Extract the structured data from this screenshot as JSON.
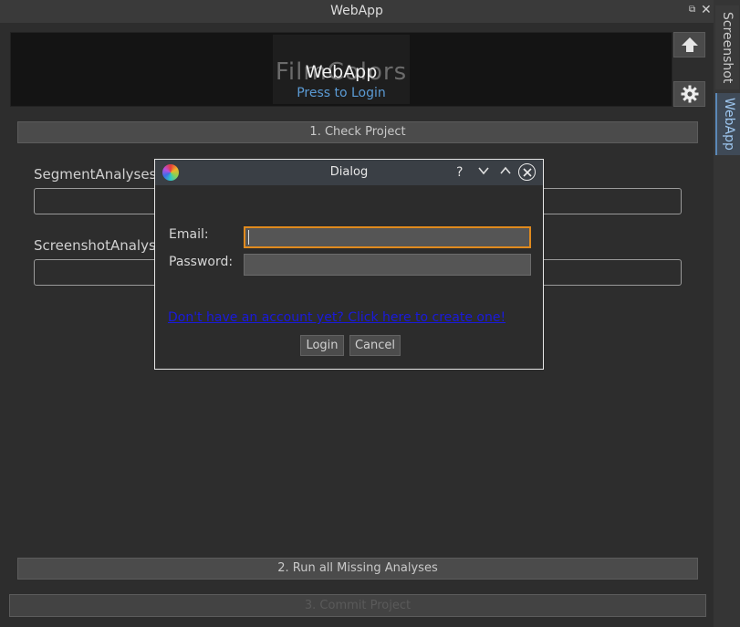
{
  "window": {
    "title": "WebApp",
    "float_glyph": "⧉",
    "close_glyph": "✕"
  },
  "side_tabs": [
    {
      "label": "Screenshot",
      "active": false
    },
    {
      "label": "WebApp",
      "active": true
    }
  ],
  "banner": {
    "ghost_text": "FilmColors",
    "title": "WebApp",
    "subtitle": "Press to Login"
  },
  "toolbar_icons": [
    {
      "name": "upload-arrow-icon"
    },
    {
      "name": "gear-icon"
    }
  ],
  "buttons": {
    "check_project": "1. Check Project",
    "run_missing": "2. Run all Missing Analyses",
    "commit_project": "3. Commit Project"
  },
  "fields": {
    "segment_label": "SegmentAnalyses",
    "screenshot_label": "ScreenshotAnalys"
  },
  "dialog": {
    "title": "Dialog",
    "help_glyph": "?",
    "min_glyph": "⌄",
    "max_glyph": "⌃",
    "email_label": "Email:",
    "email_value": "",
    "password_label": "Password:",
    "password_value": "",
    "signup_link": "Don't have an account yet? Click here to create one!",
    "login_label": "Login",
    "cancel_label": "Cancel"
  },
  "colors": {
    "accent_focus": "#e08a1e",
    "link": "#1a1adc",
    "banner_subtitle": "#5b9bd5",
    "active_tab": "#9dc6ef"
  }
}
